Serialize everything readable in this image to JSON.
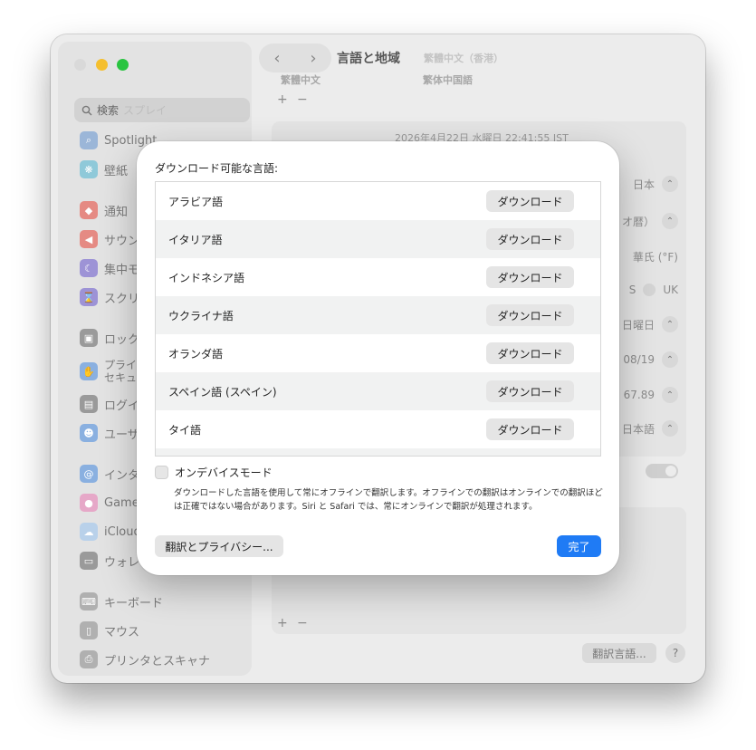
{
  "window": {
    "title": "言語と地域",
    "nav_back": "‹",
    "nav_forward": "›",
    "sidebar": {
      "search_placeholder": "検索",
      "search_ghost_text": "スプレイ",
      "items": [
        {
          "label": "Spotlight",
          "icon": "spotlight-icon",
          "color": "#9bb6d8"
        },
        {
          "label": "壁紙",
          "icon": "wallpaper-icon",
          "color": "#8fc9d9"
        },
        {
          "label": "通知",
          "icon": "notifications-icon",
          "color": "#e58a83"
        },
        {
          "label": "サウンド",
          "icon": "sound-icon",
          "color": "#e58a83"
        },
        {
          "label": "集中モード",
          "icon": "focus-icon",
          "color": "#9d93d6"
        },
        {
          "label": "スクリーンタイム",
          "icon": "screen-time-icon",
          "color": "#9d93d6"
        },
        {
          "label": "ロック画面",
          "icon": "lock-screen-icon",
          "color": "#9a9a9a"
        },
        {
          "label": "プライバシーとセキュリティ",
          "line1": "プライバ",
          "line2": "セキュリ",
          "icon": "privacy-icon",
          "color": "#8ab0e0"
        },
        {
          "label": "ログイン",
          "icon": "login-icon",
          "color": "#9a9a9a"
        },
        {
          "label": "ユーザとグループ",
          "icon": "users-icon",
          "color": "#8ab0e0"
        },
        {
          "label": "インターネットアカウント",
          "icon": "internet-accounts-icon",
          "color": "#8ab0e0"
        },
        {
          "label": "Game Center",
          "icon": "game-center-icon",
          "color": "#e6a8c8"
        },
        {
          "label": "iCloud",
          "icon": "icloud-icon",
          "color": "#b9d1ea"
        },
        {
          "label": "ウォレット",
          "icon": "wallet-icon",
          "color": "#9a9a9a"
        },
        {
          "label": "キーボード",
          "icon": "keyboard-icon",
          "color": "#b0b0b0"
        },
        {
          "label": "マウス",
          "icon": "mouse-icon",
          "color": "#b0b0b0"
        },
        {
          "label": "プリンタとスキャナ",
          "icon": "printer-icon",
          "color": "#b0b0b0"
        }
      ]
    },
    "main": {
      "header_left": "繁體中文",
      "header_right": "繁体中国語",
      "header_top_ghost": "繁體中文（香港）",
      "plus": "+",
      "minus": "−",
      "datetime": "2026年4月22日 水曜日 22:41:55 JST",
      "rows": [
        {
          "value": "日本"
        },
        {
          "value": "オ暦）"
        },
        {
          "value": "華氏 (°F)"
        },
        {
          "value_left": "S",
          "value_right": "UK"
        },
        {
          "value": "日曜日"
        },
        {
          "value": "08/19"
        },
        {
          "value": "67.89"
        },
        {
          "value": "日本語"
        }
      ],
      "translate_languages_button": "翻訳言語...",
      "help_button": "?"
    }
  },
  "dialog": {
    "title": "ダウンロード可能な言語:",
    "languages": [
      {
        "name": "アラビア語",
        "button": "ダウンロード"
      },
      {
        "name": "イタリア語",
        "button": "ダウンロード"
      },
      {
        "name": "インドネシア語",
        "button": "ダウンロード"
      },
      {
        "name": "ウクライナ語",
        "button": "ダウンロード"
      },
      {
        "name": "オランダ語",
        "button": "ダウンロード"
      },
      {
        "name": "スペイン語 (スペイン)",
        "button": "ダウンロード"
      },
      {
        "name": "タイ語",
        "button": "ダウンロード"
      }
    ],
    "on_device_mode_label": "オンデバイスモード",
    "on_device_mode_checked": false,
    "on_device_description": "ダウンロードした言語を使用して常にオフラインで翻訳します。オフラインでの翻訳はオンラインでの翻訳ほどは正確ではない場合があります。Siri と Safari では、常にオンラインで翻訳が処理されます。",
    "privacy_button": "翻訳とプライバシー...",
    "done_button": "完了",
    "accent_color": "#1f7bf5"
  }
}
